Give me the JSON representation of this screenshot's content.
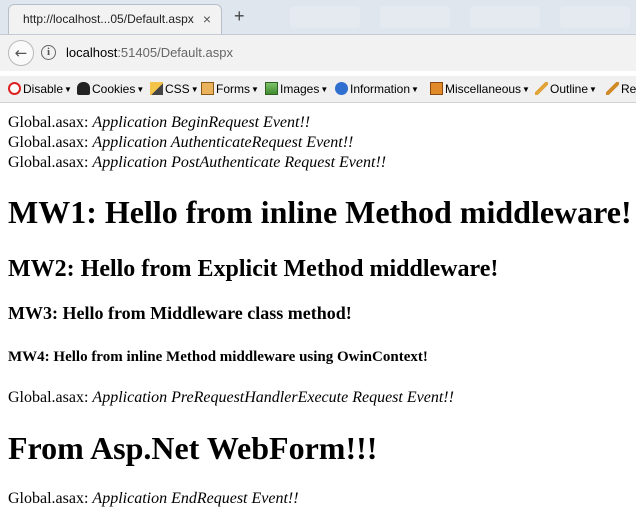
{
  "tab": {
    "title": "http://localhost...05/Default.aspx",
    "close": "×",
    "new_tab": "+"
  },
  "address": {
    "scheme": "localhost",
    "port": ":51405",
    "path": "/Default.aspx"
  },
  "icons": {
    "back": "back-arrow-icon",
    "info": "info-icon",
    "new_tab": "plus-icon",
    "close": "close-icon"
  },
  "toolbar": {
    "items": [
      {
        "label": "Disable",
        "icon": "disable-icon"
      },
      {
        "label": "Cookies",
        "icon": "cookies-icon"
      },
      {
        "label": "CSS",
        "icon": "css-icon"
      },
      {
        "label": "Forms",
        "icon": "forms-icon"
      },
      {
        "label": "Images",
        "icon": "images-icon"
      },
      {
        "label": "Information",
        "icon": "information-icon"
      },
      {
        "label": "Miscellaneous",
        "icon": "miscellaneous-icon"
      },
      {
        "label": "Outline",
        "icon": "outline-icon"
      },
      {
        "label": "Res",
        "icon": "resize-icon"
      }
    ]
  },
  "content": {
    "events_top": [
      {
        "prefix": "Global.asax: ",
        "event": "Application BeginRequest Event!!"
      },
      {
        "prefix": "Global.asax: ",
        "event": "Application AuthenticateRequest Event!!"
      },
      {
        "prefix": "Global.asax: ",
        "event": "Application PostAuthenticate Request Event!!"
      }
    ],
    "mw1": "MW1: Hello from inline Method middleware!",
    "mw2": "MW2: Hello from Explicit Method middleware!",
    "mw3": "MW3: Hello from Middleware class method!",
    "mw4": "MW4: Hello from inline Method middleware using OwinContext!",
    "event_prehandler": {
      "prefix": "Global.asax: ",
      "event": "Application PreRequestHandlerExecute Request Event!!"
    },
    "webform": "From Asp.Net WebForm!!!",
    "event_end": {
      "prefix": "Global.asax: ",
      "event": "Application EndRequest Event!!"
    }
  }
}
